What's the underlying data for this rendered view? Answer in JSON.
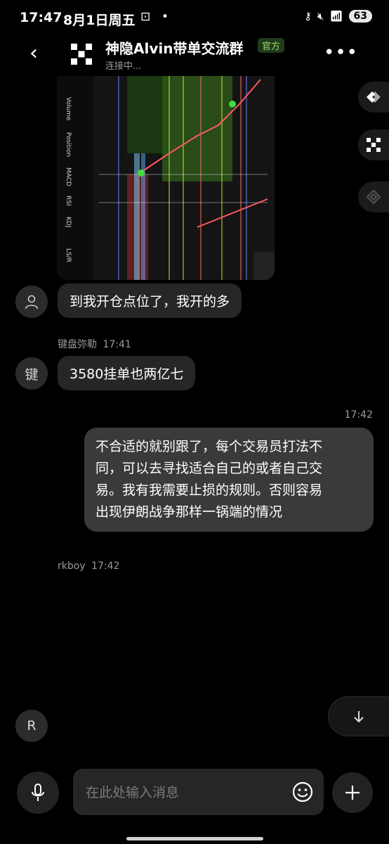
{
  "status": {
    "time": "17:47",
    "date": "8月1日周五",
    "battery": "63",
    "colors": {
      "battery_bg": "#e8e8e8"
    }
  },
  "header": {
    "title": "神隐Alvin带单交流群",
    "badge": "官方",
    "subtitle": "连接中...",
    "icons": [
      "back-arrow-icon",
      "group-logo-icon",
      "more-icon"
    ]
  },
  "floating_buttons": [
    "share-icon",
    "x-logo-icon",
    "binance-icon"
  ],
  "messages": [
    {
      "type": "image",
      "desc": "trading chart screenshot"
    },
    {
      "type": "text",
      "direction": "incoming",
      "avatar": "user-icon",
      "text": "到我开仓点位了，我开的多"
    },
    {
      "type": "text",
      "direction": "incoming",
      "sender": "键盘弥勒",
      "time": "17:41",
      "avatar": "键",
      "text": "3580挂单也两亿七"
    },
    {
      "type": "text",
      "direction": "outgoing",
      "time": "17:42",
      "lines": [
        "不合适的就别跟了，每个交易员打法不",
        "同，可以去寻找适合自己的或者自己交",
        "易。我有我需要止损的规则。否则容易",
        "出现伊朗战争那样一锅端的情况"
      ]
    },
    {
      "type": "text",
      "direction": "incoming",
      "sender": "rkboy",
      "time": "17:42",
      "avatar": "R"
    }
  ],
  "composer": {
    "placeholder": "在此处输入消息",
    "icons": [
      "mic-icon",
      "emoji-icon",
      "plus-icon"
    ]
  },
  "colors": {
    "background": "#000000",
    "bubble_in": "#262626",
    "bubble_out": "#3a3a3a",
    "badge_green": "#9fd86b"
  }
}
